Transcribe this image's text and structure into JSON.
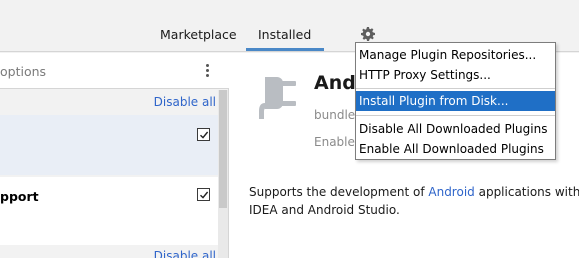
{
  "tabs": {
    "marketplace": "Marketplace",
    "installed": "Installed"
  },
  "left_panel": {
    "search_options_text": "options",
    "disable_all_top": "Disable all",
    "row2_title": "pport",
    "disable_all_bottom": "Disable all"
  },
  "plugin_detail": {
    "name": "Andr",
    "subtitle": "bundle",
    "enable_button": "Enable",
    "description_prefix": "Supports the development of ",
    "description_link": "Android",
    "description_suffix": " applications with I",
    "description_line2": "IDEA and Android Studio."
  },
  "settings_menu": {
    "items": [
      "Manage Plugin Repositories...",
      "HTTP Proxy Settings...",
      "Install Plugin from Disk...",
      "Disable All Downloaded Plugins",
      "Enable All Downloaded Plugins"
    ],
    "highlighted_index": 2
  },
  "colors": {
    "accent": "#4a88c7",
    "link": "#2f65ca",
    "menu_highlight": "#1f6fc6"
  }
}
